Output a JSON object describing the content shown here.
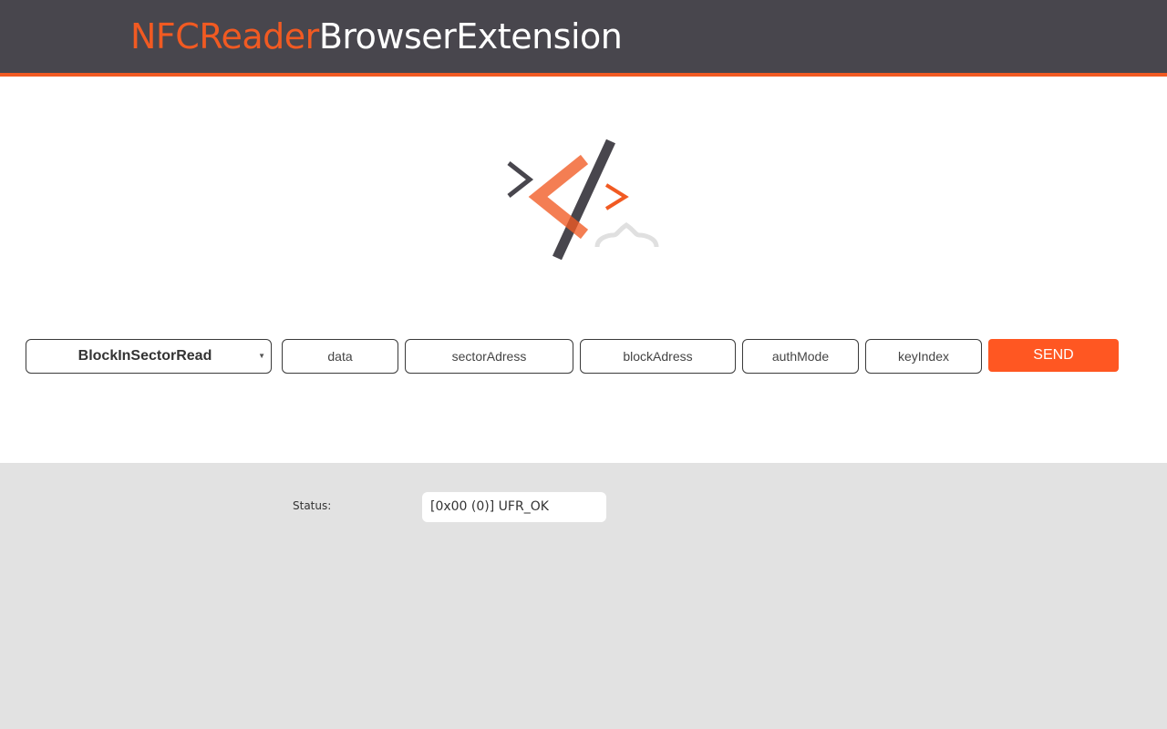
{
  "header": {
    "brand_accent": "NFCReader",
    "brand_main": "BrowserExtension"
  },
  "logo": {
    "icon": "code-logo-icon"
  },
  "controls": {
    "function_select": {
      "selected": "BlockInSectorRead"
    },
    "inputs": {
      "data": {
        "placeholder": "data"
      },
      "sector_address": {
        "placeholder": "sectorAdress"
      },
      "block_address": {
        "placeholder": "blockAdress"
      },
      "auth_mode": {
        "placeholder": "authMode"
      },
      "key_index": {
        "placeholder": "keyIndex"
      }
    },
    "send_label": "SEND"
  },
  "status": {
    "label": "Status:",
    "value": "[0x00 (0)] UFR_OK"
  },
  "colors": {
    "header_bg": "#48464d",
    "accent": "#f15a22",
    "send_button": "#ff5722",
    "panel_bg": "#e2e2e2"
  }
}
